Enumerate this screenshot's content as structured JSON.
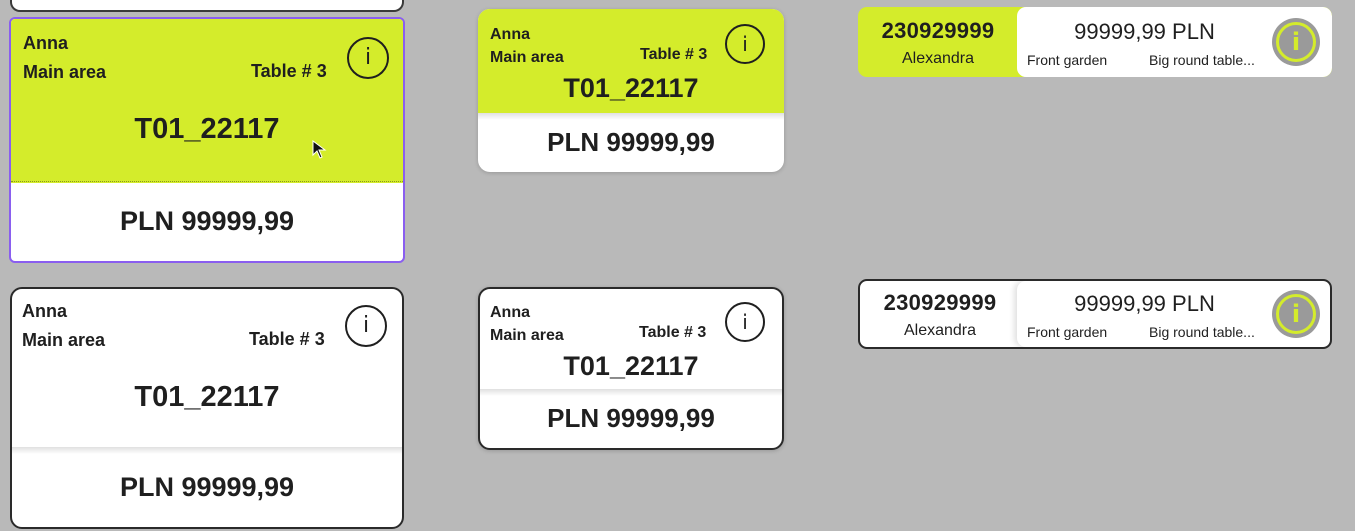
{
  "colors": {
    "canvas": "#b9b9b9",
    "accent": "#d4ec2b",
    "selection": "#8a5ef0",
    "outline": "#2a2a2a",
    "badge": "#9a9a9a"
  },
  "cards": [
    {
      "variant": "large-green-selected",
      "name": "Anna",
      "area": "Main area",
      "table": "Table # 3",
      "code": "T01_22117",
      "amount": "PLN 99999,99",
      "icon": "info-icon"
    },
    {
      "variant": "medium-green",
      "name": "Anna",
      "area": "Main area",
      "table": "Table # 3",
      "code": "T01_22117",
      "amount": "PLN 99999,99",
      "icon": "info-icon"
    },
    {
      "variant": "large-white",
      "name": "Anna",
      "area": "Main area",
      "table": "Table # 3",
      "code": "T01_22117",
      "amount": "PLN 99999,99",
      "icon": "info-icon"
    },
    {
      "variant": "medium-white",
      "name": "Anna",
      "area": "Main area",
      "table": "Table # 3",
      "code": "T01_22117",
      "amount": "PLN 99999,99",
      "icon": "info-icon"
    }
  ],
  "pills": [
    {
      "variant": "green",
      "order_id": "230929999",
      "guest": "Alexandra",
      "amount": "99999,99 PLN",
      "location": "Front garden",
      "table": "Big round table...",
      "icon": "info-icon"
    },
    {
      "variant": "white",
      "order_id": "230929999",
      "guest": "Alexandra",
      "amount": "99999,99 PLN",
      "location": "Front garden",
      "table": "Big round table...",
      "icon": "info-icon"
    }
  ],
  "icons": {
    "info_glyph": "i"
  }
}
